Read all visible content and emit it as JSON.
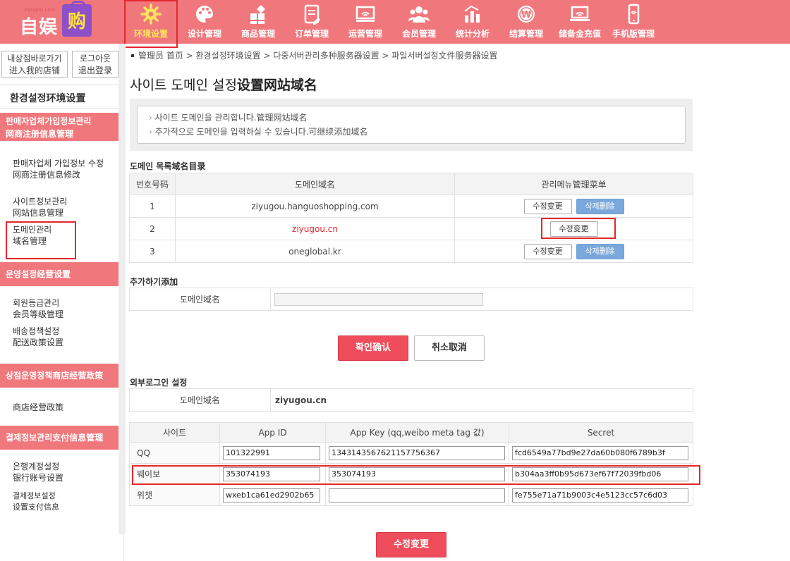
{
  "brand": {
    "small": "ziyugou.com",
    "name": "自娱",
    "bag": "购"
  },
  "nav": [
    {
      "label": "环境设置",
      "icon": "gear-icon"
    },
    {
      "label": "设计管理",
      "icon": "palette-icon"
    },
    {
      "label": "商品管理",
      "icon": "shapes-icon"
    },
    {
      "label": "订单管理",
      "icon": "order-icon"
    },
    {
      "label": "运营管理",
      "icon": "monitor-icon"
    },
    {
      "label": "会员管理",
      "icon": "members-icon"
    },
    {
      "label": "统计分析",
      "icon": "chart-icon"
    },
    {
      "label": "结算管理",
      "icon": "won-icon"
    },
    {
      "label": "储备金充值",
      "icon": "laptop-icon"
    },
    {
      "label": "手机版管理",
      "icon": "phone-icon"
    }
  ],
  "colors": {
    "accent": "#f0787d",
    "highlight": "#e5262c",
    "primary_button": "#ef4d5b",
    "delete_button": "#7aa8dc"
  },
  "sidebar": {
    "btn_store": {
      "l1": "내상점바로가기",
      "l2": "进入我的店铺"
    },
    "btn_logout": {
      "l1": "로그아웃",
      "l2": "退出登录"
    },
    "title": "환경설정环境设置",
    "sections": [
      {
        "title": [
          "판매자업체가입정보관리",
          "网商注册信息管理"
        ],
        "links": [
          {
            "l1": "판매자업체 가입정보 수정",
            "l2": "网商注册信息修改"
          },
          {
            "l1": "사이트정보관리",
            "l2": "网站信息管理"
          },
          {
            "l1": "도메인관리",
            "l2": "域名管理"
          }
        ]
      },
      {
        "title": [
          "운영설정经营设置"
        ],
        "links": [
          {
            "l1": "회원등급관리",
            "l2": "会员等级管理"
          },
          {
            "l1": "배송정책설정",
            "l2": "配送政策设置"
          }
        ]
      },
      {
        "title": [
          "상점운영정책商店经营政策"
        ],
        "links": [
          {
            "l1": "商店经营政策",
            "l2": ""
          }
        ]
      },
      {
        "title": [
          "결제정보관리支付信息管理"
        ],
        "links": [
          {
            "l1": "은행계정설정",
            "l2": "银行账号设置"
          },
          {
            "l1": "결제정보설정",
            "l2": "设置支付信息"
          }
        ]
      }
    ]
  },
  "breadcrumb": "管理员 首页 > 환경설정环境设置 > 다중서버관리多种服务器设置 > 파일서버설정文件服务器设置",
  "page_title_ko": "사이트 도메인 설정",
  "page_title_cn": "设置网站域名",
  "info": [
    "사이트 도메인을 관리합니다.管理网站域名",
    "추가적으로 도메인을 입력하실 수 있습니다.可继续添加域名"
  ],
  "domain_list": {
    "label": "도메인 목록域名目录",
    "headers": [
      "번호号码",
      "도메인域名",
      "관리메뉴管理菜单"
    ],
    "rows": [
      {
        "no": "1",
        "domain": "ziyugou.hanguoshopping.com",
        "delete": true
      },
      {
        "no": "2",
        "domain": "ziyugou.cn",
        "delete": false
      },
      {
        "no": "3",
        "domain": "oneglobal.kr",
        "delete": true
      }
    ],
    "edit_label": "수정变更",
    "delete_label": "삭제删除"
  },
  "add": {
    "label": "추가하기添加",
    "field_label": "도메인域名",
    "value": ""
  },
  "buttons": {
    "confirm": "확인确认",
    "cancel": "취소取消",
    "save": "수정变更"
  },
  "external": {
    "label": "외부로그인 설정",
    "field_label": "도메인域名",
    "domain": "ziyugou.cn"
  },
  "keys": {
    "headers": [
      "사이트",
      "App ID",
      "App Key (qq,weibo meta tag 값)",
      "Secret"
    ],
    "rows": [
      {
        "site": "QQ",
        "app_id": "101322991",
        "app_key": "1343143567621157756367",
        "secret": "fcd6549a77bd9e27da60b080f6789b3f"
      },
      {
        "site": "웨이보",
        "app_id": "353074193",
        "app_key": "353074193",
        "secret": "b304aa3ff0b95d673ef67f72039fbd06"
      },
      {
        "site": "위챗",
        "app_id": "wxeb1ca61ed2902b65",
        "app_key": "",
        "secret": "fe755e71a71b9003c4e5123cc57c6d03"
      }
    ]
  }
}
